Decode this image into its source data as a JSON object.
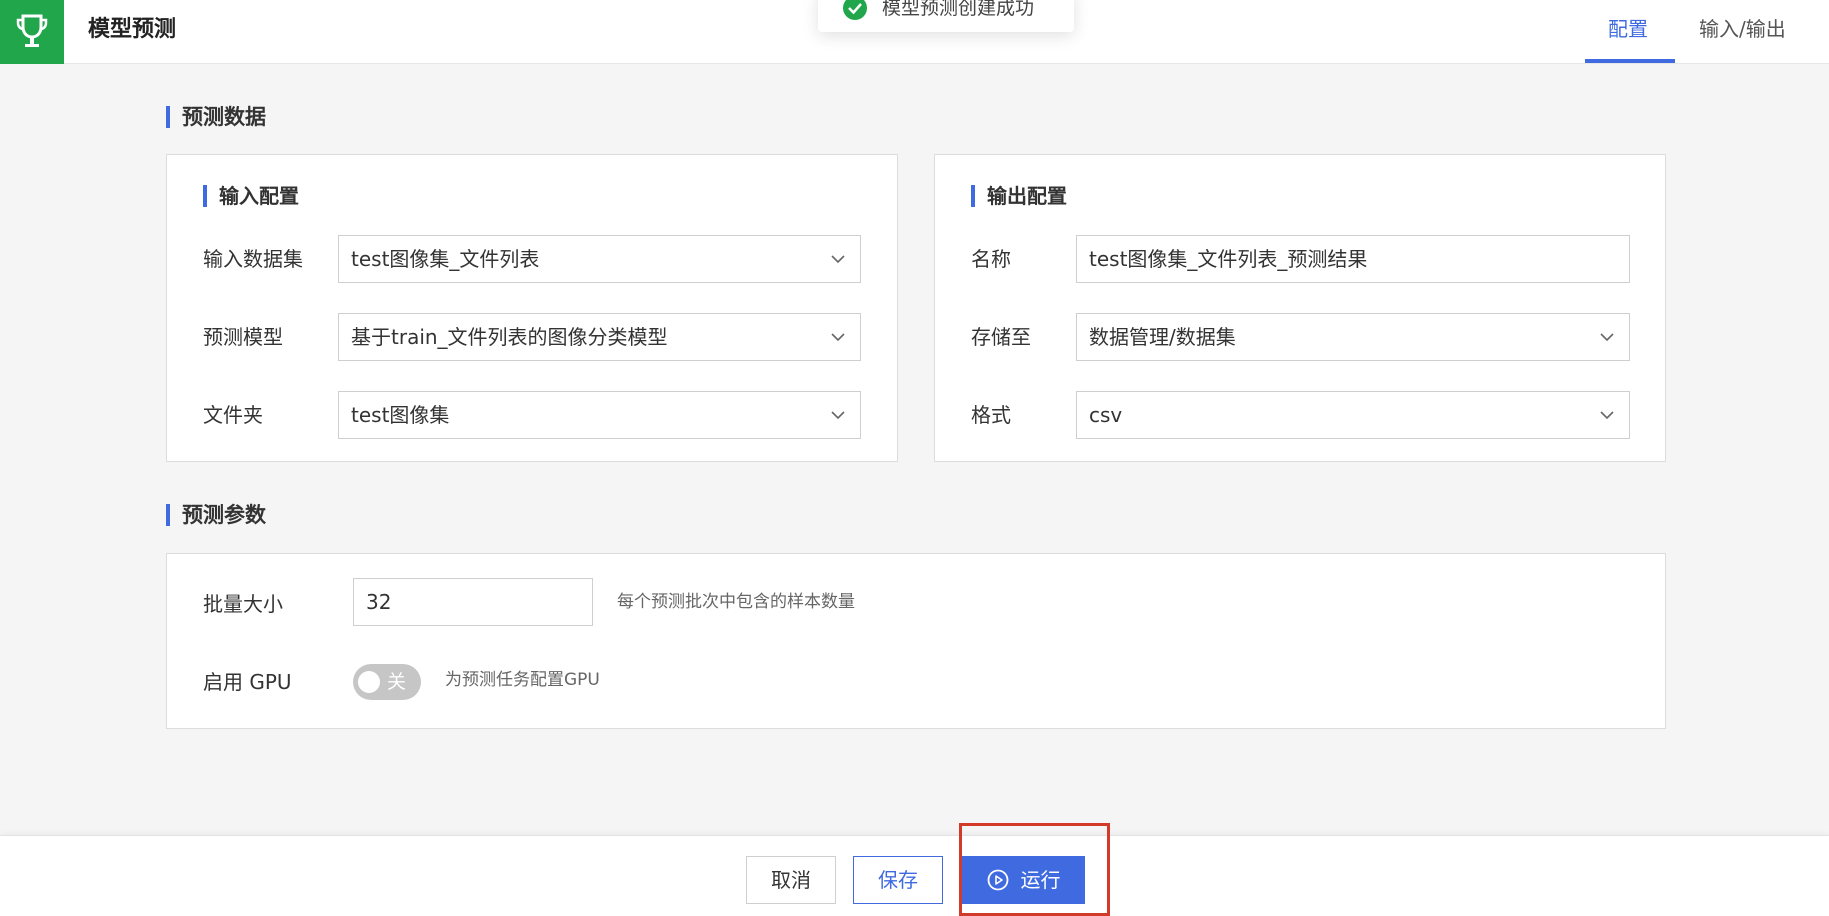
{
  "header": {
    "title": "模型预测",
    "tabs": [
      {
        "label": "配置",
        "active": true
      },
      {
        "label": "输入/输出",
        "active": false
      }
    ]
  },
  "toast": {
    "text": "模型预测创建成功",
    "icon": "check-circle-icon"
  },
  "predict_data": {
    "title": "预测数据",
    "input_config": {
      "title": "输入配置",
      "dataset_label": "输入数据集",
      "dataset_value": "test图像集_文件列表",
      "model_label": "预测模型",
      "model_value": "基于train_文件列表的图像分类模型",
      "folder_label": "文件夹",
      "folder_value": "test图像集"
    },
    "output_config": {
      "title": "输出配置",
      "name_label": "名称",
      "name_value": "test图像集_文件列表_预测结果",
      "store_label": "存储至",
      "store_value": "数据管理/数据集",
      "format_label": "格式",
      "format_value": "csv"
    }
  },
  "predict_params": {
    "title": "预测参数",
    "batch_label": "批量大小",
    "batch_value": "32",
    "batch_hint": "每个预测批次中包含的样本数量",
    "gpu_label": "启用 GPU",
    "gpu_toggle_text": "关",
    "gpu_enabled": false,
    "gpu_hint": "为预测任务配置GPU"
  },
  "footer": {
    "cancel_label": "取消",
    "save_label": "保存",
    "run_label": "运行"
  },
  "colors": {
    "accent": "#3f6ae0",
    "brand": "#21a64b",
    "highlight": "#d23b2a"
  }
}
